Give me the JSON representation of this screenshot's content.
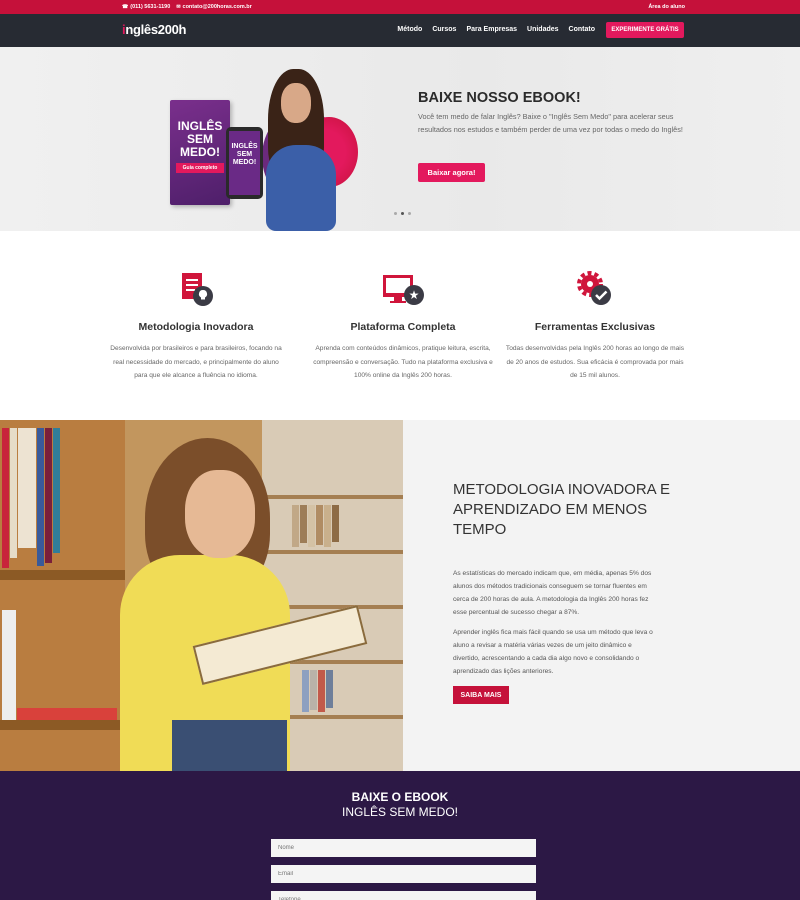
{
  "topbar": {
    "phone": "(011) 5631-1190",
    "email": "contato@200horas.com.br",
    "student_area": "Área do aluno"
  },
  "header": {
    "logo_prefix": "i",
    "logo_rest": "nglês200h",
    "nav": [
      "Método",
      "Cursos",
      "Para Empresas",
      "Unidades",
      "Contato"
    ],
    "cta": "EXPERIMENTE GRÁTIS"
  },
  "hero": {
    "book_title": "INGLÊS SEM MEDO!",
    "book_tag": "Guia completo",
    "phone_title": "INGLÊS SEM MEDO!",
    "title": "BAIXE NOSSO EBOOK!",
    "text": "Você tem medo de falar Inglês? Baixe o \"Inglês Sem Medo\" para acelerar seus resultados nos estudos e também perder de uma vez por todas o medo do Inglês!",
    "button": "Baixar agora!",
    "slides": 3,
    "active_slide": 2
  },
  "features": [
    {
      "icon": "checklist-lightbulb-icon",
      "title": "Metodologia Inovadora",
      "text": "Desenvolvida por brasileiros e para brasileiros, focando na real necessidade do mercado, e principalmente do aluno para que ele alcance a fluência no idioma."
    },
    {
      "icon": "monitor-star-icon",
      "title": "Plataforma Completa",
      "text": "Aprenda com conteúdos dinâmicos, pratique leitura, escrita, compreensão e conversação. Tudo na plataforma exclusiva e 100% online da Inglês 200 horas."
    },
    {
      "icon": "gear-check-icon",
      "title": "Ferramentas Exclusivas",
      "text": "Todas desenvolvidas pela Inglês 200 horas ao longo de mais de 20 anos de estudos. Sua eficácia é comprovada por mais de 15 mil alunos."
    }
  ],
  "method": {
    "title": "METODOLOGIA INOVADORA E APRENDIZADO EM MENOS TEMPO",
    "p1": "As estatísticas do mercado indicam que, em média, apenas 5% dos alunos dos métodos tradicionais conseguem se tornar fluentes em cerca de 200 horas de aula. A metodologia da Inglês 200 horas fez esse percentual de sucesso chegar a 87%.",
    "p2": "Aprender inglês fica mais fácil quando se usa um método que leva o aluno a revisar a matéria várias vezes de um jeito dinâmico e divertido, acrescentando a cada dia algo novo e consolidando o aprendizado das lições anteriores.",
    "button": "SAIBA MAIS"
  },
  "form": {
    "title1": "BAIXE O EBOOK",
    "title2": "INGLÊS SEM MEDO!",
    "name_placeholder": "Nome",
    "email_placeholder": "Email",
    "phone_placeholder": "Telefone"
  },
  "colors": {
    "brand_red": "#c5113a",
    "brand_pink": "#e3195d",
    "header_dark": "#272b33",
    "form_purple": "#2c1845"
  }
}
